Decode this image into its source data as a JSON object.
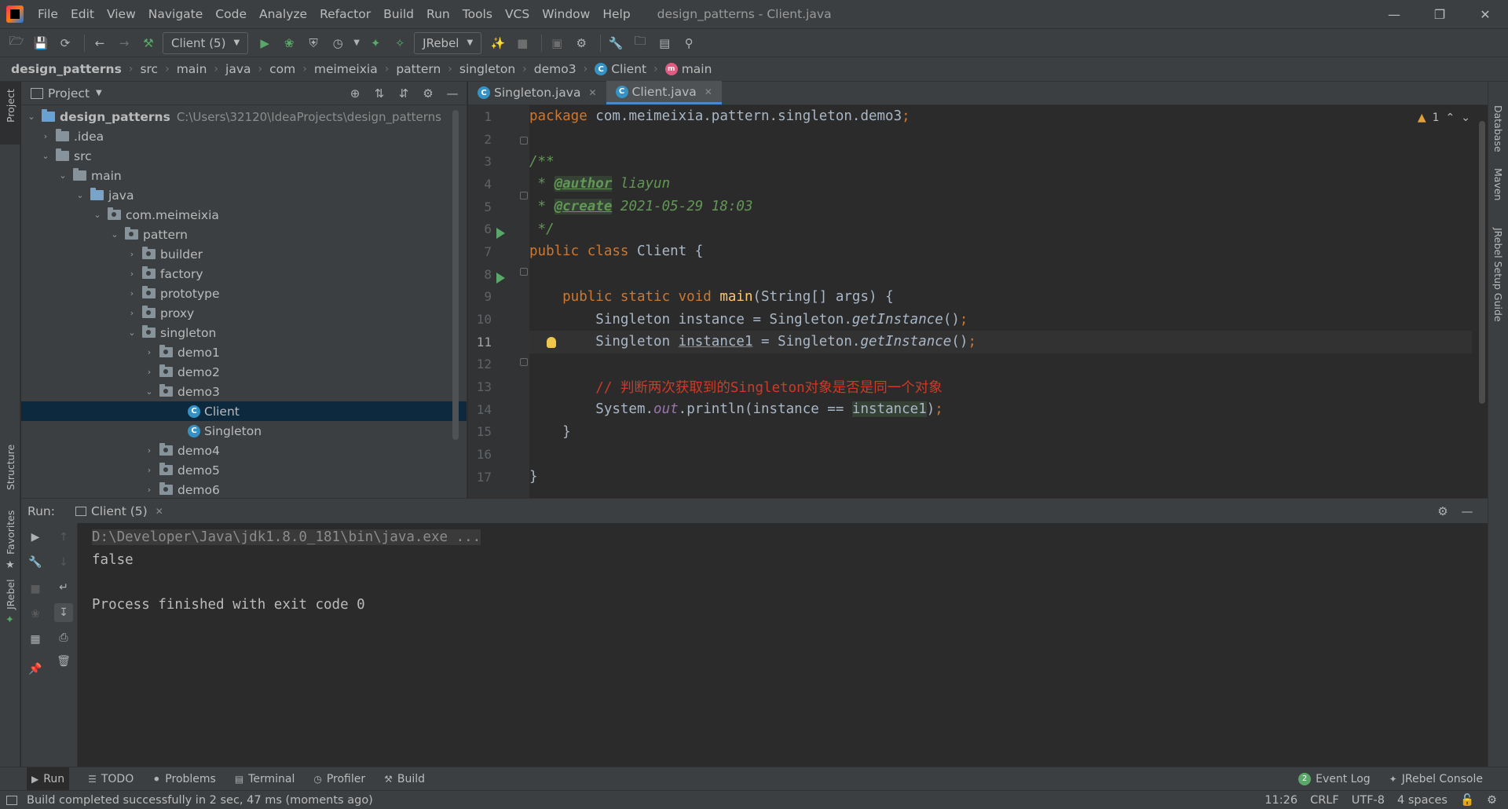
{
  "window": {
    "title": "design_patterns - Client.java",
    "menu": [
      "File",
      "Edit",
      "View",
      "Navigate",
      "Code",
      "Analyze",
      "Refactor",
      "Build",
      "Run",
      "Tools",
      "VCS",
      "Window",
      "Help"
    ]
  },
  "toolbar": {
    "run_config": "Client (5)",
    "jrebel_select": "JRebel"
  },
  "breadcrumb": [
    "design_patterns",
    "src",
    "main",
    "java",
    "com",
    "meimeixia",
    "pattern",
    "singleton",
    "demo3",
    "Client",
    "main"
  ],
  "project": {
    "title": "Project",
    "root": "design_patterns",
    "root_path": "C:\\Users\\32120\\IdeaProjects\\design_patterns",
    "nodes": [
      ".idea",
      "src",
      "main",
      "java",
      "com.meimeixia",
      "pattern",
      "builder",
      "factory",
      "prototype",
      "proxy",
      "singleton",
      "demo1",
      "demo2",
      "demo3",
      "Client",
      "Singleton",
      "demo4",
      "demo5",
      "demo6"
    ]
  },
  "editor": {
    "tabs": [
      "Singleton.java",
      "Client.java"
    ],
    "active_tab": "Client.java",
    "warning_count": "1",
    "line_numbers": [
      "1",
      "2",
      "3",
      "4",
      "5",
      "6",
      "7",
      "8",
      "9",
      "10",
      "11",
      "12",
      "13",
      "14",
      "15",
      "16",
      "17"
    ],
    "current_line": "11",
    "code": {
      "package_kw": "package",
      "package_name": " com.meimeixia.pattern.singleton.demo3",
      "semicolon": ";",
      "doc_open": "/**",
      "doc_star": " * ",
      "author_tag": "@author",
      "author_val": " liayun",
      "create_tag": "@create",
      "create_val": " 2021-05-29 18:03",
      "doc_close": " */",
      "public_class": "public class",
      "class_name": " Client {",
      "main_mods": "    public static void",
      "main_name": "main",
      "main_args": "(String[] args) {",
      "l10_a": "        Singleton instance = Singleton.",
      "l10_b": "getInstance",
      "l10_c": "()",
      "l11_a": "        Singleton ",
      "l11_b": "instance1",
      "l11_c": " = Singleton.",
      "comment": "        // 判断两次获取到的Singleton对象是否是同一个对象",
      "l14_a": "        System.",
      "l14_out": "out",
      "l14_b": ".println(instance == ",
      "l14_c": "instance1",
      "l14_d": ")",
      "close_inner": "    }",
      "close_outer": "}"
    }
  },
  "run": {
    "label": "Run:",
    "tab": "Client (5)",
    "console": [
      "D:\\Developer\\Java\\jdk1.8.0_181\\bin\\java.exe ...",
      "false",
      "",
      "Process finished with exit code 0"
    ]
  },
  "bottom_tools": [
    "Run",
    "TODO",
    "Problems",
    "Terminal",
    "Profiler",
    "Build"
  ],
  "bottom_right": {
    "event_log": "Event Log",
    "event_count": "2",
    "jrebel_console": "JRebel Console"
  },
  "side_labels": {
    "left": [
      "Project",
      "Structure",
      "Favorites",
      "JRebel"
    ],
    "right": [
      "Database",
      "Maven",
      "JRebel Setup Guide"
    ]
  },
  "status": {
    "message": "Build completed successfully in 2 sec, 47 ms (moments ago)",
    "position": "11:26",
    "line_sep": "CRLF",
    "encoding": "UTF-8",
    "indent": "4 spaces"
  },
  "colors": {
    "accent": "#4a88c7",
    "run_green": "#59a869",
    "keyword": "#cc7832",
    "doc_green": "#629755",
    "method": "#ffc66d",
    "selection": "#0d293e"
  }
}
